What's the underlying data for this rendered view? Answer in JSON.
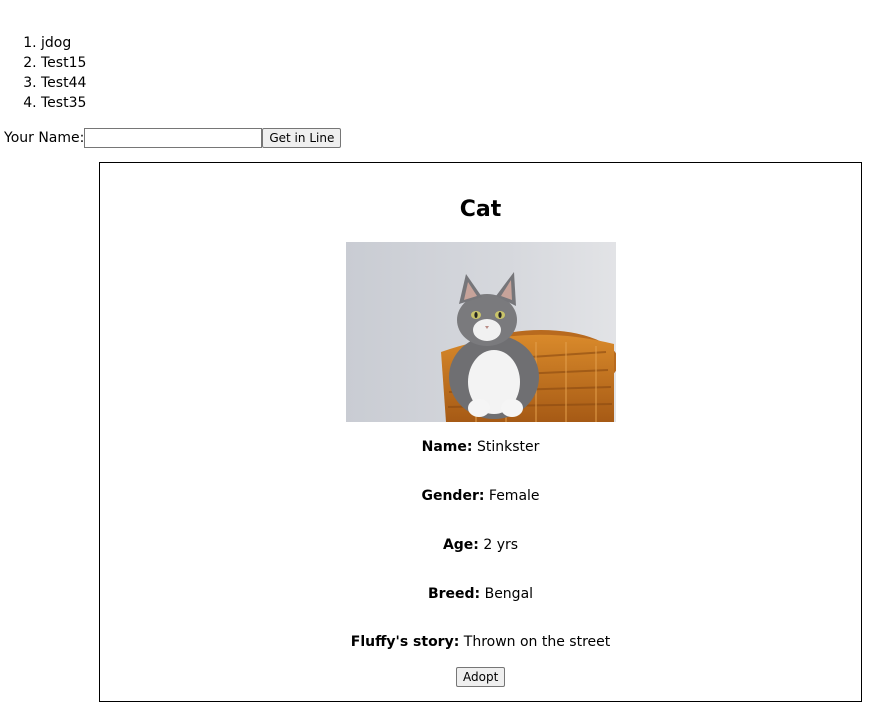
{
  "queue": [
    "jdog",
    "Test15",
    "Test44",
    "Test35"
  ],
  "form": {
    "name_label": "Your Name:",
    "name_value": "",
    "submit_label": "Get in Line"
  },
  "pet": {
    "heading": "Cat",
    "photo_icon": "cat-in-basket-photo",
    "fields": [
      {
        "label": "Name:",
        "value": "Stinkster"
      },
      {
        "label": "Gender:",
        "value": "Female"
      },
      {
        "label": "Age:",
        "value": "2 yrs"
      },
      {
        "label": "Breed:",
        "value": "Bengal"
      },
      {
        "label": "Fluffy's story:",
        "value": "Thrown on the street"
      }
    ],
    "adopt_label": "Adopt"
  }
}
